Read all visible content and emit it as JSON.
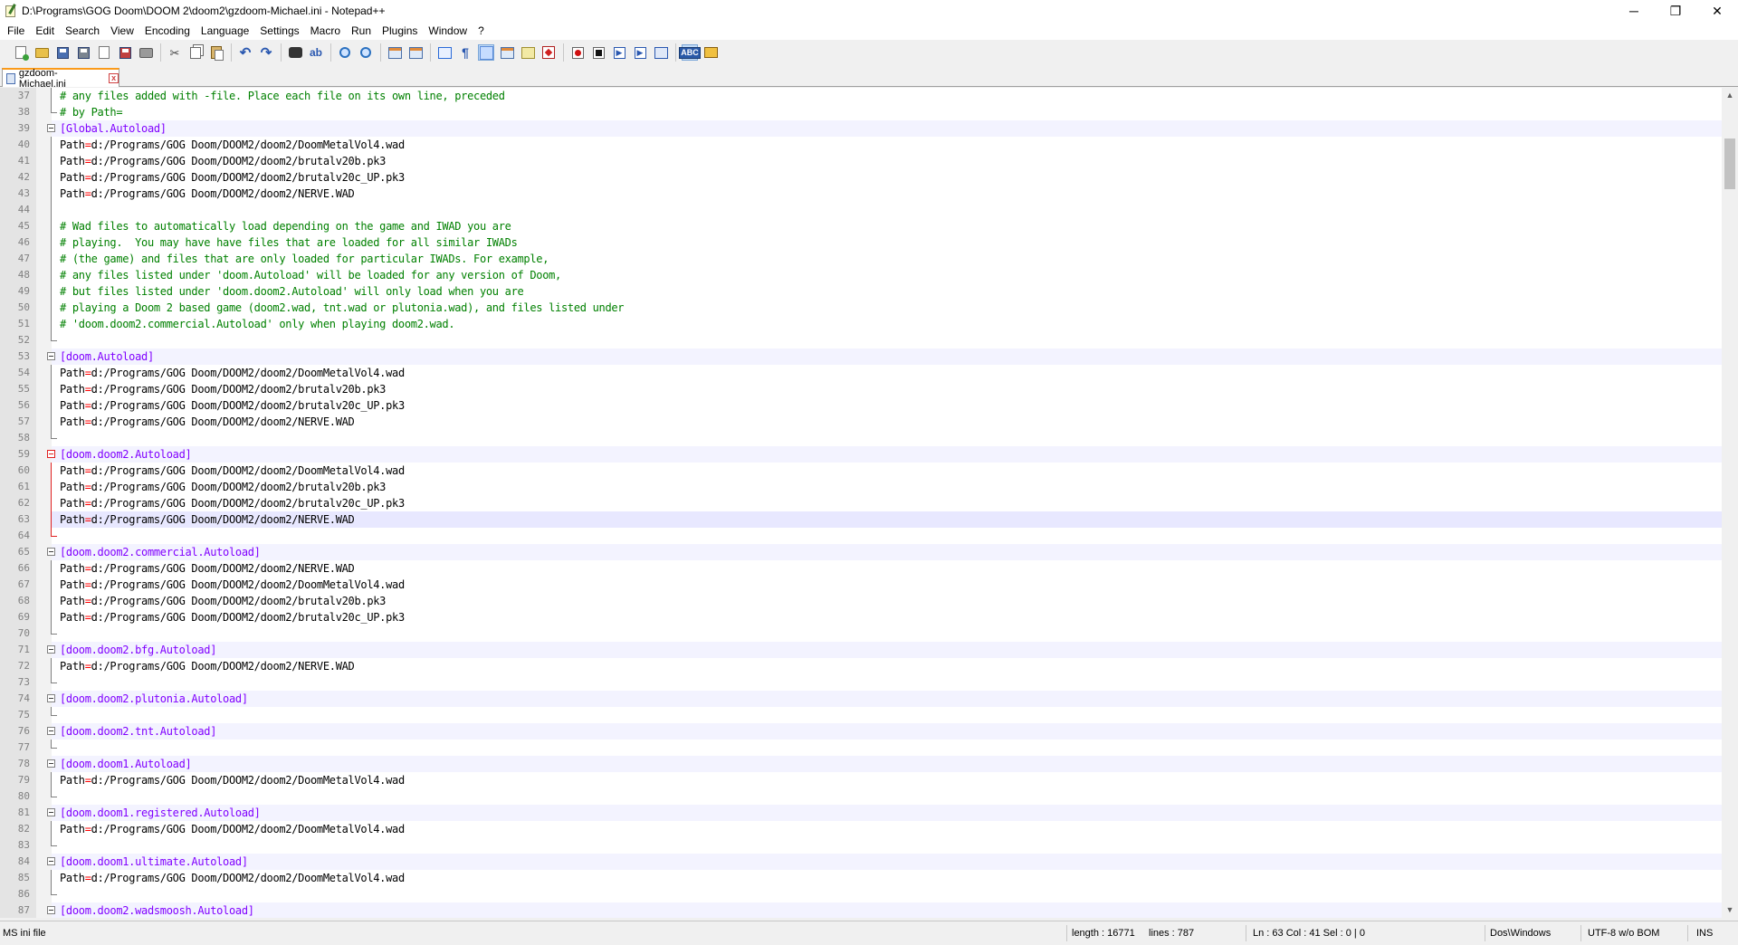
{
  "window": {
    "title": "D:\\Programs\\GOG Doom\\DOOM 2\\doom2\\gzdoom-Michael.ini - Notepad++",
    "controls": {
      "minimize": "─",
      "maximize": "❐",
      "close": "✕",
      "doc_close": "X"
    }
  },
  "menu": [
    "File",
    "Edit",
    "Search",
    "View",
    "Encoding",
    "Language",
    "Settings",
    "Macro",
    "Run",
    "Plugins",
    "Window",
    "?"
  ],
  "tab": {
    "label": "gzdoom-Michael.ini",
    "close": "x"
  },
  "editor": {
    "lines": [
      {
        "n": "37",
        "text": "# any files added with -file. Place each file on its own line, preceded",
        "kind": "comment",
        "fold": "line"
      },
      {
        "n": "38",
        "text": "# by Path=",
        "kind": "comment",
        "fold": "end"
      },
      {
        "n": "39",
        "text": "[Global.Autoload]",
        "kind": "section",
        "fold": "box",
        "bg": "fold"
      },
      {
        "n": "40",
        "text": "Path=d:/Programs/GOG Doom/DOOM2/doom2/DoomMetalVol4.wad",
        "kind": "path",
        "fold": "line"
      },
      {
        "n": "41",
        "text": "Path=d:/Programs/GOG Doom/DOOM2/doom2/brutalv20b.pk3",
        "kind": "path",
        "fold": "line"
      },
      {
        "n": "42",
        "text": "Path=d:/Programs/GOG Doom/DOOM2/doom2/brutalv20c_UP.pk3",
        "kind": "path",
        "fold": "line"
      },
      {
        "n": "43",
        "text": "Path=d:/Programs/GOG Doom/DOOM2/doom2/NERVE.WAD",
        "kind": "path",
        "fold": "line"
      },
      {
        "n": "44",
        "text": "",
        "kind": "plain",
        "fold": "line"
      },
      {
        "n": "45",
        "text": "# Wad files to automatically load depending on the game and IWAD you are",
        "kind": "comment",
        "fold": "line"
      },
      {
        "n": "46",
        "text": "# playing.  You may have have files that are loaded for all similar IWADs",
        "kind": "comment",
        "fold": "line"
      },
      {
        "n": "47",
        "text": "# (the game) and files that are only loaded for particular IWADs. For example,",
        "kind": "comment",
        "fold": "line"
      },
      {
        "n": "48",
        "text": "# any files listed under 'doom.Autoload' will be loaded for any version of Doom,",
        "kind": "comment",
        "fold": "line"
      },
      {
        "n": "49",
        "text": "# but files listed under 'doom.doom2.Autoload' will only load when you are",
        "kind": "comment",
        "fold": "line"
      },
      {
        "n": "50",
        "text": "# playing a Doom 2 based game (doom2.wad, tnt.wad or plutonia.wad), and files listed under",
        "kind": "comment",
        "fold": "line"
      },
      {
        "n": "51",
        "text": "# 'doom.doom2.commercial.Autoload' only when playing doom2.wad.",
        "kind": "comment",
        "fold": "line"
      },
      {
        "n": "52",
        "text": "",
        "kind": "plain",
        "fold": "end"
      },
      {
        "n": "53",
        "text": "[doom.Autoload]",
        "kind": "section",
        "fold": "box",
        "bg": "fold"
      },
      {
        "n": "54",
        "text": "Path=d:/Programs/GOG Doom/DOOM2/doom2/DoomMetalVol4.wad",
        "kind": "path",
        "fold": "line"
      },
      {
        "n": "55",
        "text": "Path=d:/Programs/GOG Doom/DOOM2/doom2/brutalv20b.pk3",
        "kind": "path",
        "fold": "line"
      },
      {
        "n": "56",
        "text": "Path=d:/Programs/GOG Doom/DOOM2/doom2/brutalv20c_UP.pk3",
        "kind": "path",
        "fold": "line"
      },
      {
        "n": "57",
        "text": "Path=d:/Programs/GOG Doom/DOOM2/doom2/NERVE.WAD",
        "kind": "path",
        "fold": "line"
      },
      {
        "n": "58",
        "text": "",
        "kind": "plain",
        "fold": "end"
      },
      {
        "n": "59",
        "text": "[doom.doom2.Autoload]",
        "kind": "section",
        "fold": "box-red",
        "bg": "fold"
      },
      {
        "n": "60",
        "text": "Path=d:/Programs/GOG Doom/DOOM2/doom2/DoomMetalVol4.wad",
        "kind": "path",
        "fold": "line-red"
      },
      {
        "n": "61",
        "text": "Path=d:/Programs/GOG Doom/DOOM2/doom2/brutalv20b.pk3",
        "kind": "path",
        "fold": "line-red"
      },
      {
        "n": "62",
        "text": "Path=d:/Programs/GOG Doom/DOOM2/doom2/brutalv20c_UP.pk3",
        "kind": "path",
        "fold": "line-red"
      },
      {
        "n": "63",
        "text": "Path=d:/Programs/GOG Doom/DOOM2/doom2/NERVE.WAD",
        "kind": "path",
        "fold": "line-red",
        "bg": "caret"
      },
      {
        "n": "64",
        "text": "",
        "kind": "plain",
        "fold": "end-red"
      },
      {
        "n": "65",
        "text": "[doom.doom2.commercial.Autoload]",
        "kind": "section",
        "fold": "box",
        "bg": "fold"
      },
      {
        "n": "66",
        "text": "Path=d:/Programs/GOG Doom/DOOM2/doom2/NERVE.WAD",
        "kind": "path",
        "fold": "line"
      },
      {
        "n": "67",
        "text": "Path=d:/Programs/GOG Doom/DOOM2/doom2/DoomMetalVol4.wad",
        "kind": "path",
        "fold": "line"
      },
      {
        "n": "68",
        "text": "Path=d:/Programs/GOG Doom/DOOM2/doom2/brutalv20b.pk3",
        "kind": "path",
        "fold": "line"
      },
      {
        "n": "69",
        "text": "Path=d:/Programs/GOG Doom/DOOM2/doom2/brutalv20c_UP.pk3",
        "kind": "path",
        "fold": "line"
      },
      {
        "n": "70",
        "text": "",
        "kind": "plain",
        "fold": "end"
      },
      {
        "n": "71",
        "text": "[doom.doom2.bfg.Autoload]",
        "kind": "section",
        "fold": "box",
        "bg": "fold"
      },
      {
        "n": "72",
        "text": "Path=d:/Programs/GOG Doom/DOOM2/doom2/NERVE.WAD",
        "kind": "path",
        "fold": "line"
      },
      {
        "n": "73",
        "text": "",
        "kind": "plain",
        "fold": "end"
      },
      {
        "n": "74",
        "text": "[doom.doom2.plutonia.Autoload]",
        "kind": "section",
        "fold": "box",
        "bg": "fold"
      },
      {
        "n": "75",
        "text": "",
        "kind": "plain",
        "fold": "end"
      },
      {
        "n": "76",
        "text": "[doom.doom2.tnt.Autoload]",
        "kind": "section",
        "fold": "box",
        "bg": "fold"
      },
      {
        "n": "77",
        "text": "",
        "kind": "plain",
        "fold": "end"
      },
      {
        "n": "78",
        "text": "[doom.doom1.Autoload]",
        "kind": "section",
        "fold": "box",
        "bg": "fold"
      },
      {
        "n": "79",
        "text": "Path=d:/Programs/GOG Doom/DOOM2/doom2/DoomMetalVol4.wad",
        "kind": "path",
        "fold": "line"
      },
      {
        "n": "80",
        "text": "",
        "kind": "plain",
        "fold": "end"
      },
      {
        "n": "81",
        "text": "[doom.doom1.registered.Autoload]",
        "kind": "section",
        "fold": "box",
        "bg": "fold"
      },
      {
        "n": "82",
        "text": "Path=d:/Programs/GOG Doom/DOOM2/doom2/DoomMetalVol4.wad",
        "kind": "path",
        "fold": "line"
      },
      {
        "n": "83",
        "text": "",
        "kind": "plain",
        "fold": "end"
      },
      {
        "n": "84",
        "text": "[doom.doom1.ultimate.Autoload]",
        "kind": "section",
        "fold": "box",
        "bg": "fold"
      },
      {
        "n": "85",
        "text": "Path=d:/Programs/GOG Doom/DOOM2/doom2/DoomMetalVol4.wad",
        "kind": "path",
        "fold": "line"
      },
      {
        "n": "86",
        "text": "",
        "kind": "plain",
        "fold": "end"
      },
      {
        "n": "87",
        "text": "[doom.doom2.wadsmoosh.Autoload]",
        "kind": "section",
        "fold": "box",
        "bg": "fold"
      }
    ]
  },
  "status": {
    "language": "MS ini file",
    "length": "length : 16771",
    "lines": "lines : 787",
    "position": "Ln : 63    Col : 41    Sel : 0 | 0",
    "eol": "Dos\\Windows",
    "encoding": "UTF-8 w/o BOM",
    "mode": "INS"
  },
  "colors": {
    "comment": "#008000",
    "section": "#8000ff",
    "operator": "#ff0000",
    "caret_line": "#e8e8ff",
    "fold_highlight": "#e02020",
    "tab_accent": "#fa9a1a"
  }
}
